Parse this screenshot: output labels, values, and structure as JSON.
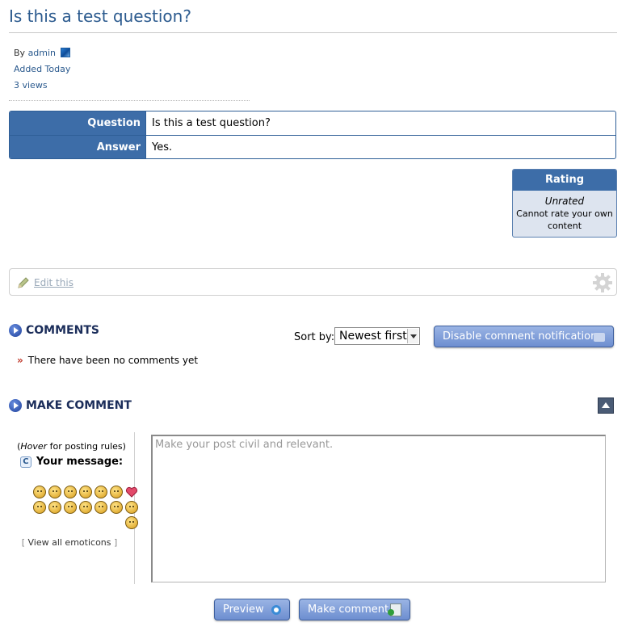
{
  "page": {
    "title": "Is this a test question?"
  },
  "meta": {
    "by_label": "By",
    "author": "admin",
    "added": "Added Today",
    "views": "3 views"
  },
  "qa": {
    "question_label": "Question",
    "question_value": "Is this a test question?",
    "answer_label": "Answer",
    "answer_value": "Yes."
  },
  "rating": {
    "header": "Rating",
    "status": "Unrated",
    "note": "Cannot rate your own content"
  },
  "edit": {
    "link_label": "Edit this"
  },
  "comments": {
    "heading": "COMMENTS",
    "sort_label": "Sort by:",
    "sort_selected": "Newest first",
    "notifications_button": "Disable comment notifications",
    "empty_message": "There have been no comments yet"
  },
  "make_comment": {
    "heading": "MAKE COMMENT",
    "hover_word": "Hover",
    "hover_rest": " for posting rules",
    "your_message_label": "Your message:",
    "view_all_emoticons": "View all emoticons",
    "textarea_placeholder": "Make your post civil and relevant.",
    "preview_button": "Preview",
    "submit_button": "Make comment"
  },
  "colors": {
    "accent": "#3d6da8",
    "title": "#2b5a8e",
    "heading": "#1b2d5a",
    "button": "#7f9dd9"
  },
  "icons": {
    "author_badge": "admin-badge-icon",
    "pencil": "pencil-icon",
    "gear": "gear-icon",
    "section_bullet": "play-bullet-icon",
    "collapse": "collapse-up-icon",
    "preview": "preview-icon",
    "make_comment": "comment-add-icon"
  }
}
